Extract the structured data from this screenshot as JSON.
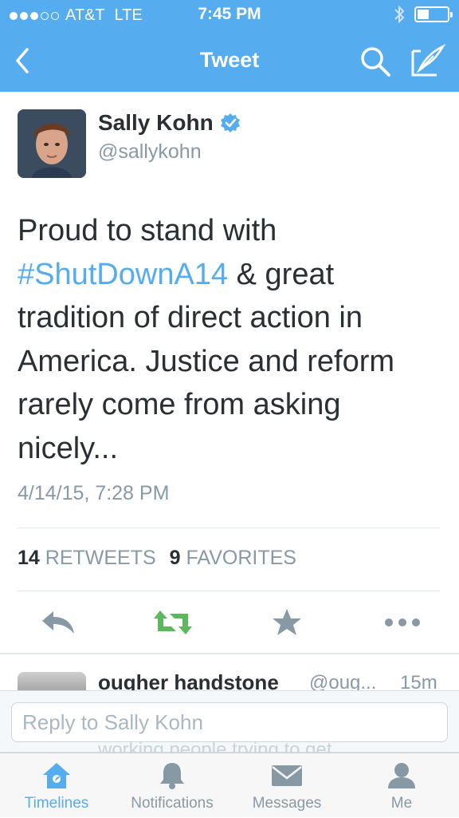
{
  "status_bar": {
    "carrier": "AT&T",
    "network": "LTE",
    "time": "7:45 PM",
    "signal_bars_filled": 3,
    "signal_bars_total": 5
  },
  "nav": {
    "title": "Tweet",
    "icons": [
      "back-chevron-icon",
      "search-icon",
      "compose-icon"
    ]
  },
  "tweet": {
    "author_name": "Sally Kohn",
    "verified": true,
    "handle": "@sallykohn",
    "text_before": "Proud to stand with ",
    "hashtag": "#ShutDownA14",
    "text_after": " & great tradition of direct action in America. Justice and reform rarely come from asking nicely...",
    "timestamp": "4/14/15, 7:28 PM",
    "retweet_count": "14",
    "retweet_label": "RETWEETS",
    "favorite_count": "9",
    "favorite_label": "FAVORITES"
  },
  "actions": [
    "reply-icon",
    "retweet-icon",
    "favorite-icon",
    "more-icon"
  ],
  "reply_preview": {
    "name": "ougher handstone",
    "handle": "@oug...",
    "time": "15m",
    "text_fragment": "working people trying to get"
  },
  "reply_box": {
    "placeholder": "Reply to Sally Kohn"
  },
  "tabs": [
    {
      "label": "Timelines",
      "icon": "home-icon",
      "active": true
    },
    {
      "label": "Notifications",
      "icon": "bell-icon",
      "active": false
    },
    {
      "label": "Messages",
      "icon": "envelope-icon",
      "active": false
    },
    {
      "label": "Me",
      "icon": "person-icon",
      "active": false
    }
  ],
  "colors": {
    "brand": "#55acee",
    "text": "#292f33",
    "secondary": "#8899a6",
    "retweet_green": "#5cb85c",
    "action_gray": "#8899a6"
  }
}
